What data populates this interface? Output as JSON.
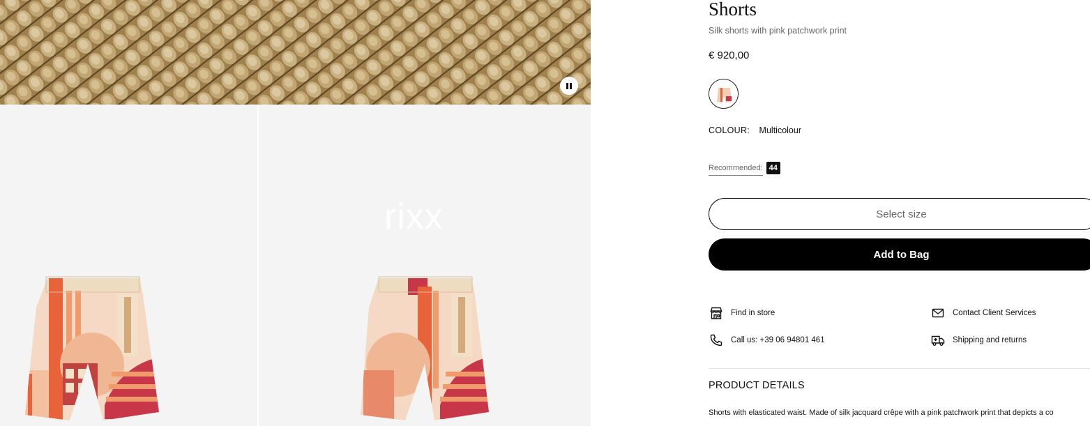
{
  "product": {
    "title": "Shorts",
    "subtitle": "Silk shorts with pink patchwork print",
    "price": "€ 920,00"
  },
  "colour": {
    "label": "COLOUR:",
    "value": "Multicolour"
  },
  "size": {
    "recommended_label": "Recommended:",
    "recommended_value": "44",
    "select_label": "Select size"
  },
  "cart": {
    "add_label": "Add to Bag"
  },
  "services": {
    "find_store": "Find in store",
    "call": "Call us: +39 06 94801 461",
    "contact": "Contact Client Services",
    "shipping": "Shipping and returns"
  },
  "details": {
    "title": "PRODUCT DETAILS",
    "text": "Shorts with elasticated waist. Made of silk jacquard crêpe with a pink patchwork print that depicts a co"
  },
  "media": {
    "watermark": "rixx"
  },
  "icons": {
    "pause": "pause-icon",
    "store": "store-icon",
    "phone": "phone-icon",
    "mail": "mail-icon",
    "truck": "truck-icon"
  }
}
